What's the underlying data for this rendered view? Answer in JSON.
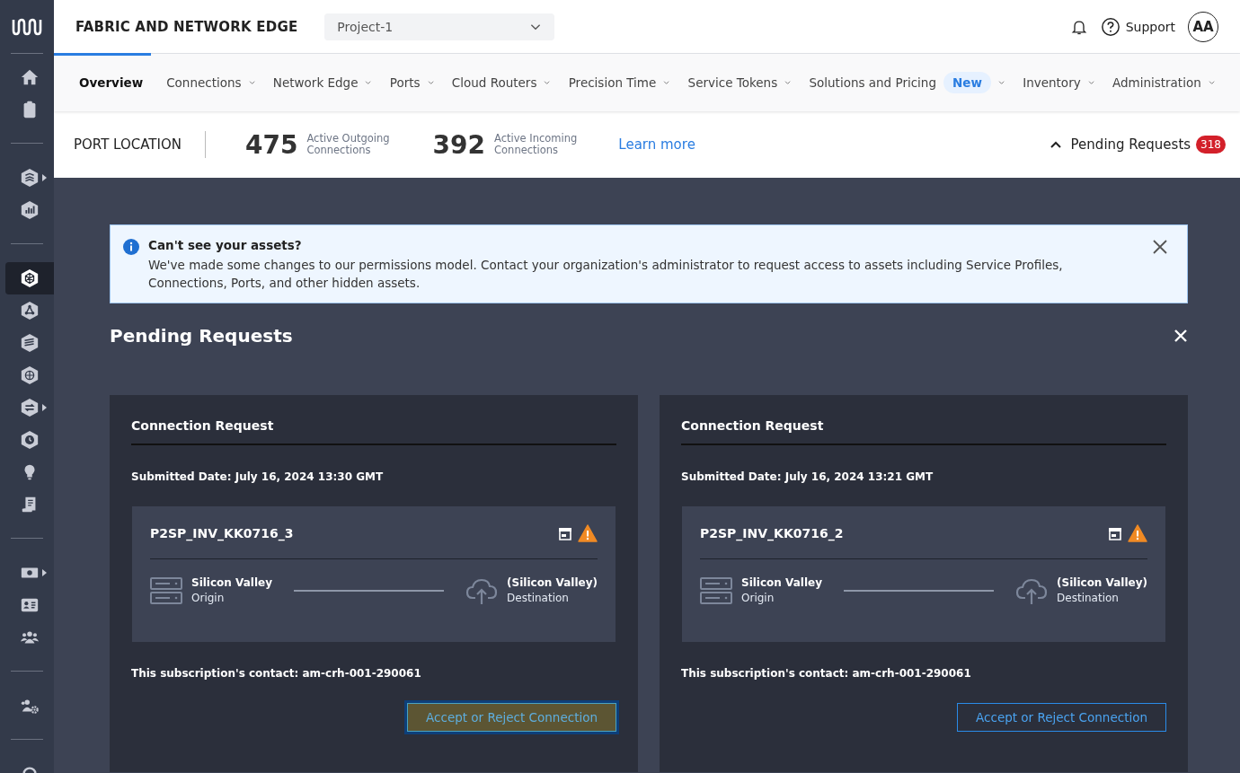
{
  "sidebar": {
    "groups": [
      [
        {
          "selected": false,
          "submenu": false
        },
        {
          "selected": false,
          "submenu": false
        }
      ],
      [
        {
          "selected": false,
          "submenu": true
        },
        {
          "selected": false,
          "submenu": false
        }
      ],
      [
        {
          "selected": true,
          "submenu": false
        },
        {
          "selected": false,
          "submenu": false
        },
        {
          "selected": false,
          "submenu": false
        },
        {
          "selected": false,
          "submenu": false
        },
        {
          "selected": false,
          "submenu": true
        },
        {
          "selected": false,
          "submenu": false
        },
        {
          "selected": false,
          "submenu": false
        },
        {
          "selected": false,
          "submenu": false
        }
      ],
      [
        {
          "selected": false,
          "submenu": true
        },
        {
          "selected": false,
          "submenu": false
        },
        {
          "selected": false,
          "submenu": false
        }
      ],
      [
        {
          "selected": false,
          "submenu": false
        }
      ],
      [
        {
          "selected": false,
          "submenu": false
        }
      ]
    ]
  },
  "header": {
    "title": "FABRIC AND NETWORK EDGE",
    "project_select": {
      "value": "Project-1"
    },
    "support": "Support",
    "avatar": "AA"
  },
  "nav": {
    "tabs": [
      {
        "label": "Overview",
        "selected": true,
        "dropdown": false
      },
      {
        "label": "Connections",
        "selected": false,
        "dropdown": true
      },
      {
        "label": "Network Edge",
        "selected": false,
        "dropdown": true
      },
      {
        "label": "Ports",
        "selected": false,
        "dropdown": true
      },
      {
        "label": "Cloud Routers",
        "selected": false,
        "dropdown": true
      },
      {
        "label": "Precision Time",
        "selected": false,
        "dropdown": true
      },
      {
        "label": "Service Tokens",
        "selected": false,
        "dropdown": true
      },
      {
        "label": "Solutions and Pricing",
        "selected": false,
        "dropdown": true,
        "badge": "New"
      },
      {
        "label": "Inventory",
        "selected": false,
        "dropdown": true
      },
      {
        "label": "Administration",
        "selected": false,
        "dropdown": true
      }
    ]
  },
  "stats_bar": {
    "title": "PORT LOCATION",
    "stats": [
      {
        "value": "475",
        "label_1": "Active Outgoing",
        "label_2": "Connections"
      },
      {
        "value": "392",
        "label_1": "Active Incoming",
        "label_2": "Connections"
      }
    ],
    "learn_more": "Learn more",
    "pending": {
      "label": "Pending Requests",
      "count": "318",
      "expanded": true
    }
  },
  "banner": {
    "title": "Can't see your assets?",
    "message": "We've made some changes to our permissions model. Contact your organization's administrator to request access to assets including Service Profiles, Connections, Ports, and other hidden assets."
  },
  "pending_panel": {
    "title": "Pending Requests",
    "cards": [
      {
        "title": "Connection Request",
        "submitted": "Submitted Date: July 16, 2024 13:30 GMT",
        "name": "P2SP_INV_KK0716_3",
        "origin": "Silicon Valley",
        "origin_label": "Origin",
        "destination": "(Silicon Valley)",
        "destination_label": "Destination",
        "contact": "This subscription's contact: am-crh-001-290061",
        "button": "Accept or Reject Connection",
        "focused": true
      },
      {
        "title": "Connection Request",
        "submitted": "Submitted Date: July 16, 2024 13:21 GMT",
        "name": "P2SP_INV_KK0716_2",
        "origin": "Silicon Valley",
        "origin_label": "Origin",
        "destination": "(Silicon Valley)",
        "destination_label": "Destination",
        "contact": "This subscription's contact: am-crh-001-290061",
        "button": "Accept or Reject Connection",
        "focused": false
      }
    ]
  }
}
